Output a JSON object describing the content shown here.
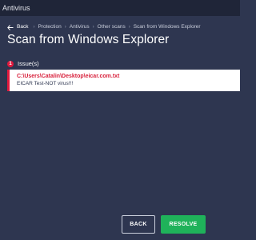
{
  "window": {
    "title": "Antivirus"
  },
  "breadcrumb": {
    "back_label": "Back",
    "items": [
      "Protection",
      "Antivirus",
      "Other scans",
      "Scan from Windows Explorer"
    ],
    "separator": "›"
  },
  "page": {
    "title": "Scan from Windows Explorer"
  },
  "issues": {
    "count": "1",
    "label": "Issue(s)",
    "items": [
      {
        "path": "C:\\Users\\Catalin\\Desktop\\eicar.com.txt",
        "name": "EICAR Test-NOT virus!!!"
      }
    ]
  },
  "actions": {
    "back_label": "BACK",
    "resolve_label": "RESOLVE"
  },
  "colors": {
    "background": "#2e3650",
    "accent_red": "#e0193d",
    "accent_green": "#1fb25a"
  }
}
